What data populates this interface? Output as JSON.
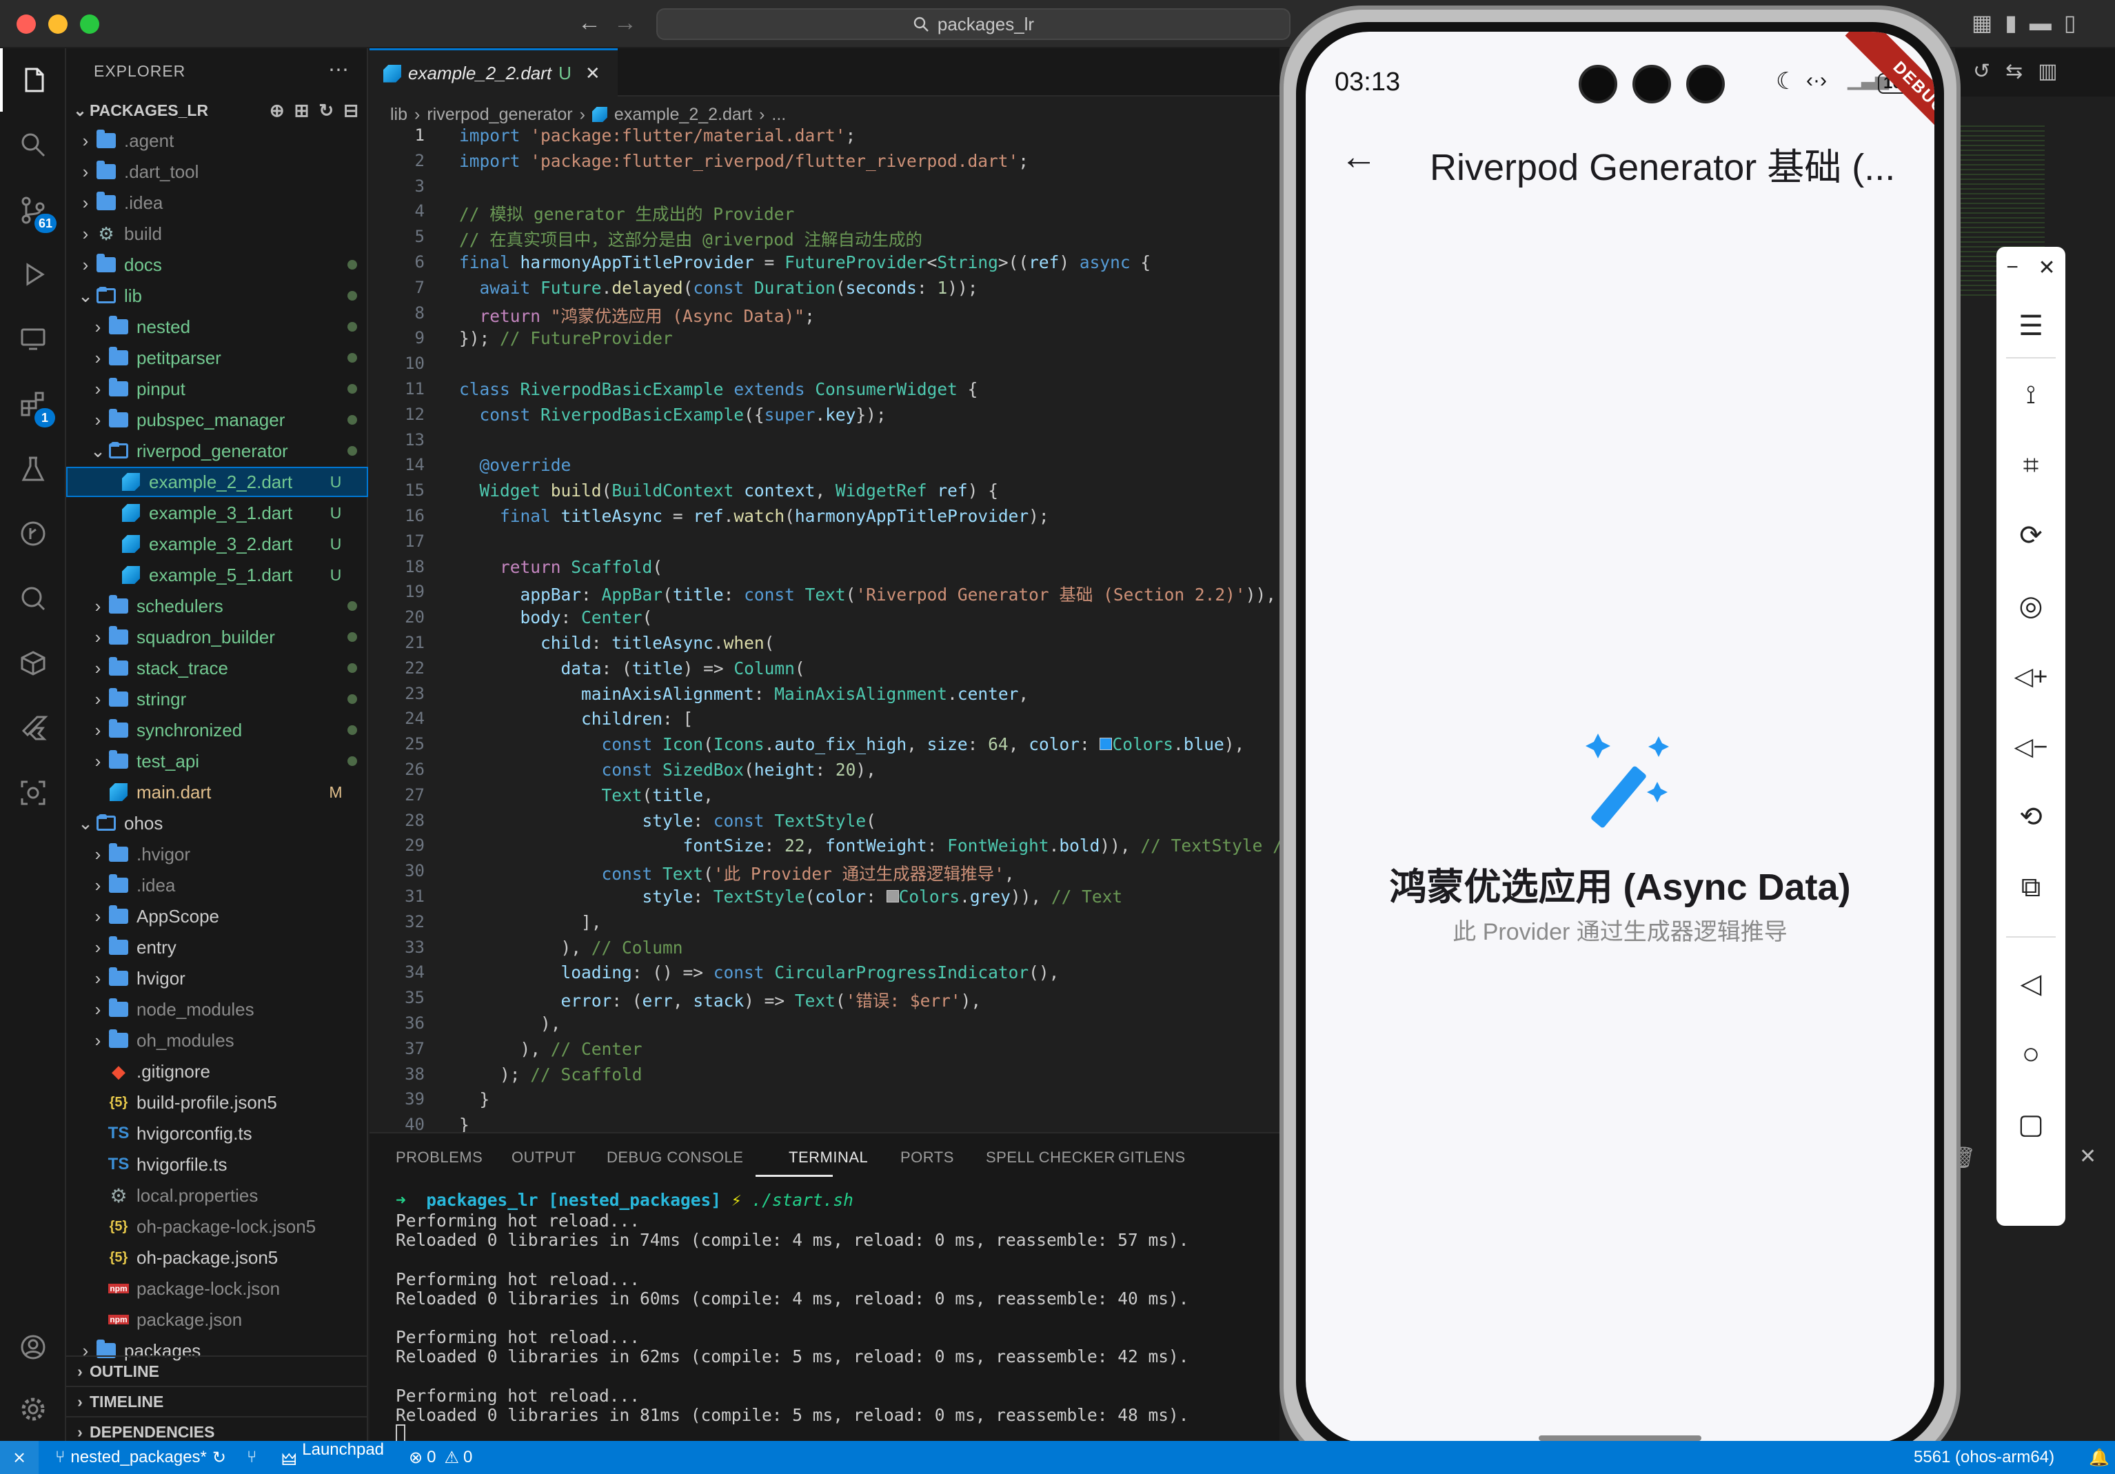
{
  "window": {
    "search": "packages_lr"
  },
  "activity": {
    "scm_badge": "61",
    "ext_badge": "1"
  },
  "sidebar": {
    "title": "EXPLORER",
    "root": "PACKAGES_LR",
    "tree": [
      {
        "label": ".agent",
        "depth": 0,
        "type": "folder"
      },
      {
        "label": ".dart_tool",
        "depth": 0,
        "type": "folder"
      },
      {
        "label": ".idea",
        "depth": 0,
        "type": "folder"
      },
      {
        "label": "build",
        "depth": 0,
        "type": "folder-gear"
      },
      {
        "label": "docs",
        "depth": 0,
        "type": "folder",
        "dot": true
      },
      {
        "label": "lib",
        "depth": 0,
        "type": "folder-open",
        "dot": true
      },
      {
        "label": "nested",
        "depth": 1,
        "type": "folder",
        "dot": true
      },
      {
        "label": "petitparser",
        "depth": 1,
        "type": "folder",
        "dot": true
      },
      {
        "label": "pinput",
        "depth": 1,
        "type": "folder",
        "dot": true
      },
      {
        "label": "pubspec_manager",
        "depth": 1,
        "type": "folder",
        "dot": true
      },
      {
        "label": "riverpod_generator",
        "depth": 1,
        "type": "folder-open",
        "dot": true
      },
      {
        "label": "example_2_2.dart",
        "depth": 2,
        "type": "dart",
        "badge": "U",
        "selected": true
      },
      {
        "label": "example_3_1.dart",
        "depth": 2,
        "type": "dart",
        "badge": "U"
      },
      {
        "label": "example_3_2.dart",
        "depth": 2,
        "type": "dart",
        "badge": "U"
      },
      {
        "label": "example_5_1.dart",
        "depth": 2,
        "type": "dart",
        "badge": "U"
      },
      {
        "label": "schedulers",
        "depth": 1,
        "type": "folder",
        "dot": true
      },
      {
        "label": "squadron_builder",
        "depth": 1,
        "type": "folder",
        "dot": true
      },
      {
        "label": "stack_trace",
        "depth": 1,
        "type": "folder",
        "dot": true
      },
      {
        "label": "stringr",
        "depth": 1,
        "type": "folder",
        "dot": true
      },
      {
        "label": "synchronized",
        "depth": 1,
        "type": "folder",
        "dot": true
      },
      {
        "label": "test_api",
        "depth": 1,
        "type": "folder",
        "dot": true
      },
      {
        "label": "main.dart",
        "depth": 1,
        "type": "dart",
        "badge": "M"
      },
      {
        "label": "ohos",
        "depth": 0,
        "type": "folder-open"
      },
      {
        "label": ".hvigor",
        "depth": 1,
        "type": "folder"
      },
      {
        "label": ".idea",
        "depth": 1,
        "type": "folder"
      },
      {
        "label": "AppScope",
        "depth": 1,
        "type": "folder"
      },
      {
        "label": "entry",
        "depth": 1,
        "type": "folder"
      },
      {
        "label": "hvigor",
        "depth": 1,
        "type": "folder"
      },
      {
        "label": "node_modules",
        "depth": 1,
        "type": "folder"
      },
      {
        "label": "oh_modules",
        "depth": 1,
        "type": "folder"
      },
      {
        "label": ".gitignore",
        "depth": 1,
        "type": "git"
      },
      {
        "label": "build-profile.json5",
        "depth": 1,
        "type": "json"
      },
      {
        "label": "hvigorconfig.ts",
        "depth": 1,
        "type": "ts"
      },
      {
        "label": "hvigorfile.ts",
        "depth": 1,
        "type": "ts"
      },
      {
        "label": "local.properties",
        "depth": 1,
        "type": "gear"
      },
      {
        "label": "oh-package-lock.json5",
        "depth": 1,
        "type": "json"
      },
      {
        "label": "oh-package.json5",
        "depth": 1,
        "type": "json"
      },
      {
        "label": "package-lock.json",
        "depth": 1,
        "type": "npm"
      },
      {
        "label": "package.json",
        "depth": 1,
        "type": "npm"
      },
      {
        "label": "packages",
        "depth": 0,
        "type": "folder"
      }
    ],
    "sections": [
      "OUTLINE",
      "TIMELINE",
      "DEPENDENCIES"
    ]
  },
  "editor": {
    "tab_label": "example_2_2.dart",
    "tab_badge": "U",
    "breadcrumb": [
      "lib",
      "riverpod_generator",
      "example_2_2.dart",
      "..."
    ]
  },
  "panel": {
    "tabs": [
      "PROBLEMS",
      "OUTPUT",
      "DEBUG CONSOLE",
      "TERMINAL",
      "PORTS",
      "SPELL CHECKER",
      "GITLENS"
    ],
    "active_tab": "TERMINAL",
    "prompt_dir": "packages_lr",
    "prompt_branch": "[nested_packages]",
    "prompt_cmd": "./start.sh",
    "lines": [
      "Performing hot reload...",
      "Reloaded 0 libraries in 74ms (compile: 4 ms, reload: 0 ms, reassemble: 57 ms).",
      "",
      "Performing hot reload...",
      "Reloaded 0 libraries in 60ms (compile: 4 ms, reload: 0 ms, reassemble: 40 ms).",
      "",
      "Performing hot reload...",
      "Reloaded 0 libraries in 62ms (compile: 5 ms, reload: 0 ms, reassemble: 42 ms).",
      "",
      "Performing hot reload...",
      "Reloaded 0 libraries in 81ms (compile: 5 ms, reload: 0 ms, reassemble: 48 ms)."
    ]
  },
  "statusbar": {
    "branch": "nested_packages*",
    "launchpad": "Launchpad",
    "errors": "0",
    "warnings": "0",
    "device": "5561 (ohos-arm64)"
  },
  "phone": {
    "time": "03:13",
    "battery": "100",
    "debug_banner": "DEBUG",
    "appbar_title": "Riverpod Generator 基础 (...",
    "headline": "鸿蒙优选应用 (Async Data)",
    "subtext": "此 Provider 通过生成器逻辑推导"
  },
  "colors": {
    "accent": "#0078d4",
    "icon_blue": "#2196f3",
    "statusbar": "#0078d4"
  }
}
